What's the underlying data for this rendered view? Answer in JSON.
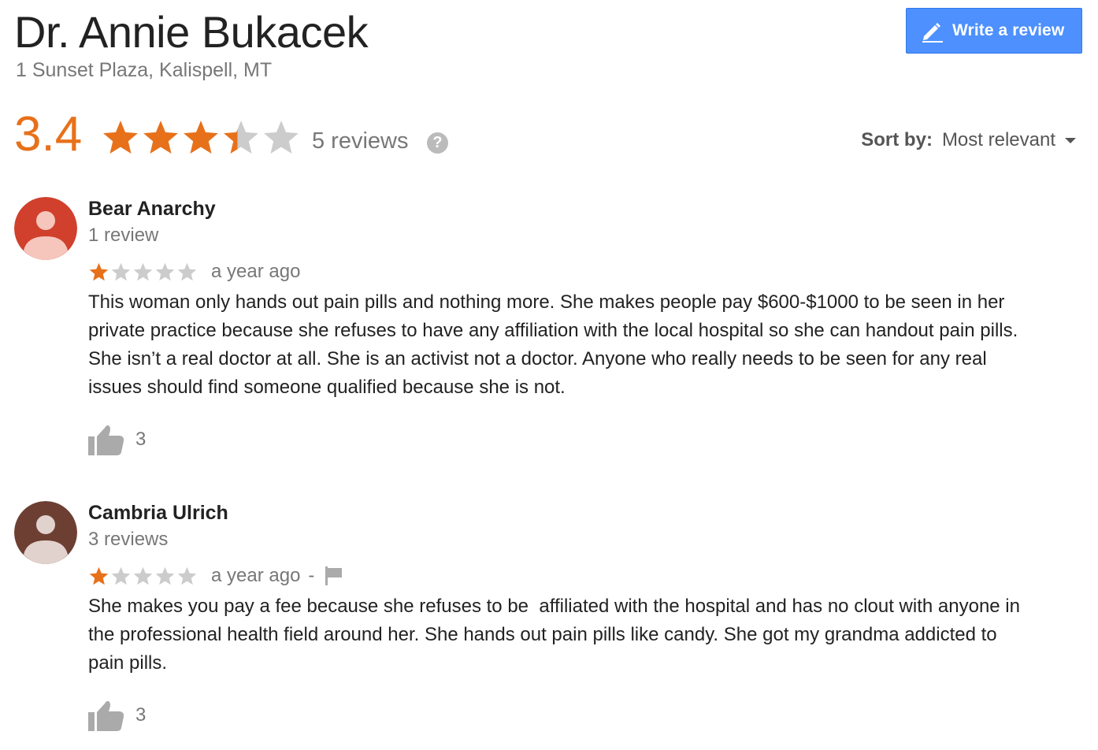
{
  "doctor": {
    "name": "Dr. Annie Bukacek",
    "address": "1 Sunset Plaza, Kalispell, MT"
  },
  "write_review_label": "Write a review",
  "rating": {
    "value": "3.4",
    "stars_filled": 3.4,
    "reviews_label": "5 reviews",
    "help_icon": "?"
  },
  "sort": {
    "label": "Sort by:",
    "value": "Most relevant"
  },
  "colors": {
    "accent_orange": "#e7711b",
    "button_blue": "#4d90fe",
    "star_empty": "#cccccc",
    "avatar_1": "#d0402c",
    "avatar_2": "#6d3f33"
  },
  "icons": {
    "pen": "pencil-icon",
    "thumb": "thumbs-up-icon",
    "flag": "flag-icon",
    "avatar": "person-icon"
  },
  "reviews": [
    {
      "author": "Bear Anarchy",
      "author_reviews": "1 review",
      "stars": 1,
      "time": "a year ago",
      "text": "This woman only hands out pain pills and nothing more. She makes people pay $600-$1000 to be seen in her private practice because she refuses to have any affiliation with the local hospital so she can handout pain pills. She isn’t a real doctor at all. She is an activist not a doctor. Anyone who really needs to be seen for any real issues should find someone qualified because she is not.",
      "helpful": "3"
    },
    {
      "author": "Cambria Ulrich",
      "author_reviews": "3 reviews",
      "stars": 1,
      "time": "a year ago",
      "separator": "-",
      "text": "She makes you pay a fee because she refuses to be  affiliated with the hospital and has no clout with anyone in the professional health field around her. She hands out pain pills like candy. She got my grandma addicted to pain pills.",
      "helpful": "3"
    }
  ]
}
